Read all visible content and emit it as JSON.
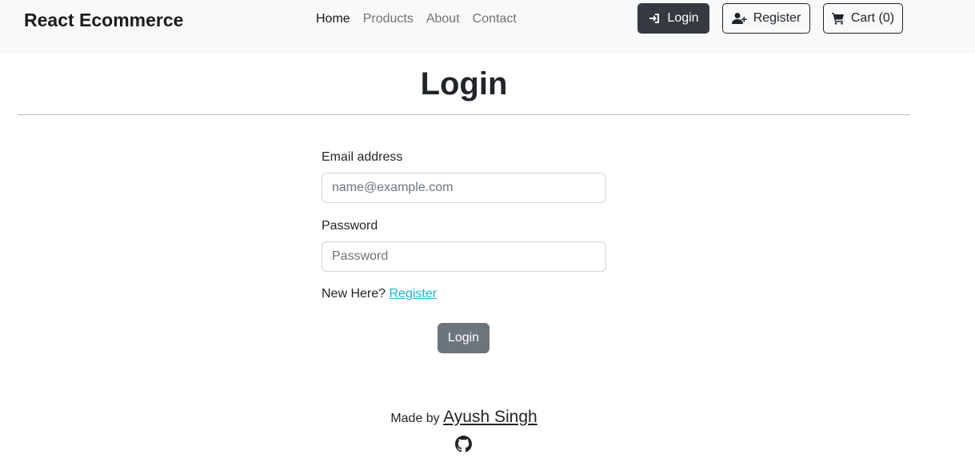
{
  "navbar": {
    "brand": "React Ecommerce",
    "links": [
      {
        "label": "Home",
        "active": true
      },
      {
        "label": "Products",
        "active": false
      },
      {
        "label": "About",
        "active": false
      },
      {
        "label": "Contact",
        "active": false
      }
    ],
    "login_label": "Login",
    "register_label": "Register",
    "cart_label": "Cart (0)"
  },
  "page": {
    "title": "Login"
  },
  "form": {
    "email_label": "Email address",
    "email_placeholder": "name@example.com",
    "password_label": "Password",
    "password_placeholder": "Password",
    "new_here_text": "New Here?",
    "register_link": "Register",
    "submit_label": "Login"
  },
  "footer": {
    "made_by": "Made by",
    "author": "Ayush Singh",
    "icon": "github-icon"
  },
  "colors": {
    "navbar_bg": "#f8f9fa",
    "dark_button": "#343a40",
    "submit_button": "#6c757d",
    "link": "#20b2d6"
  }
}
